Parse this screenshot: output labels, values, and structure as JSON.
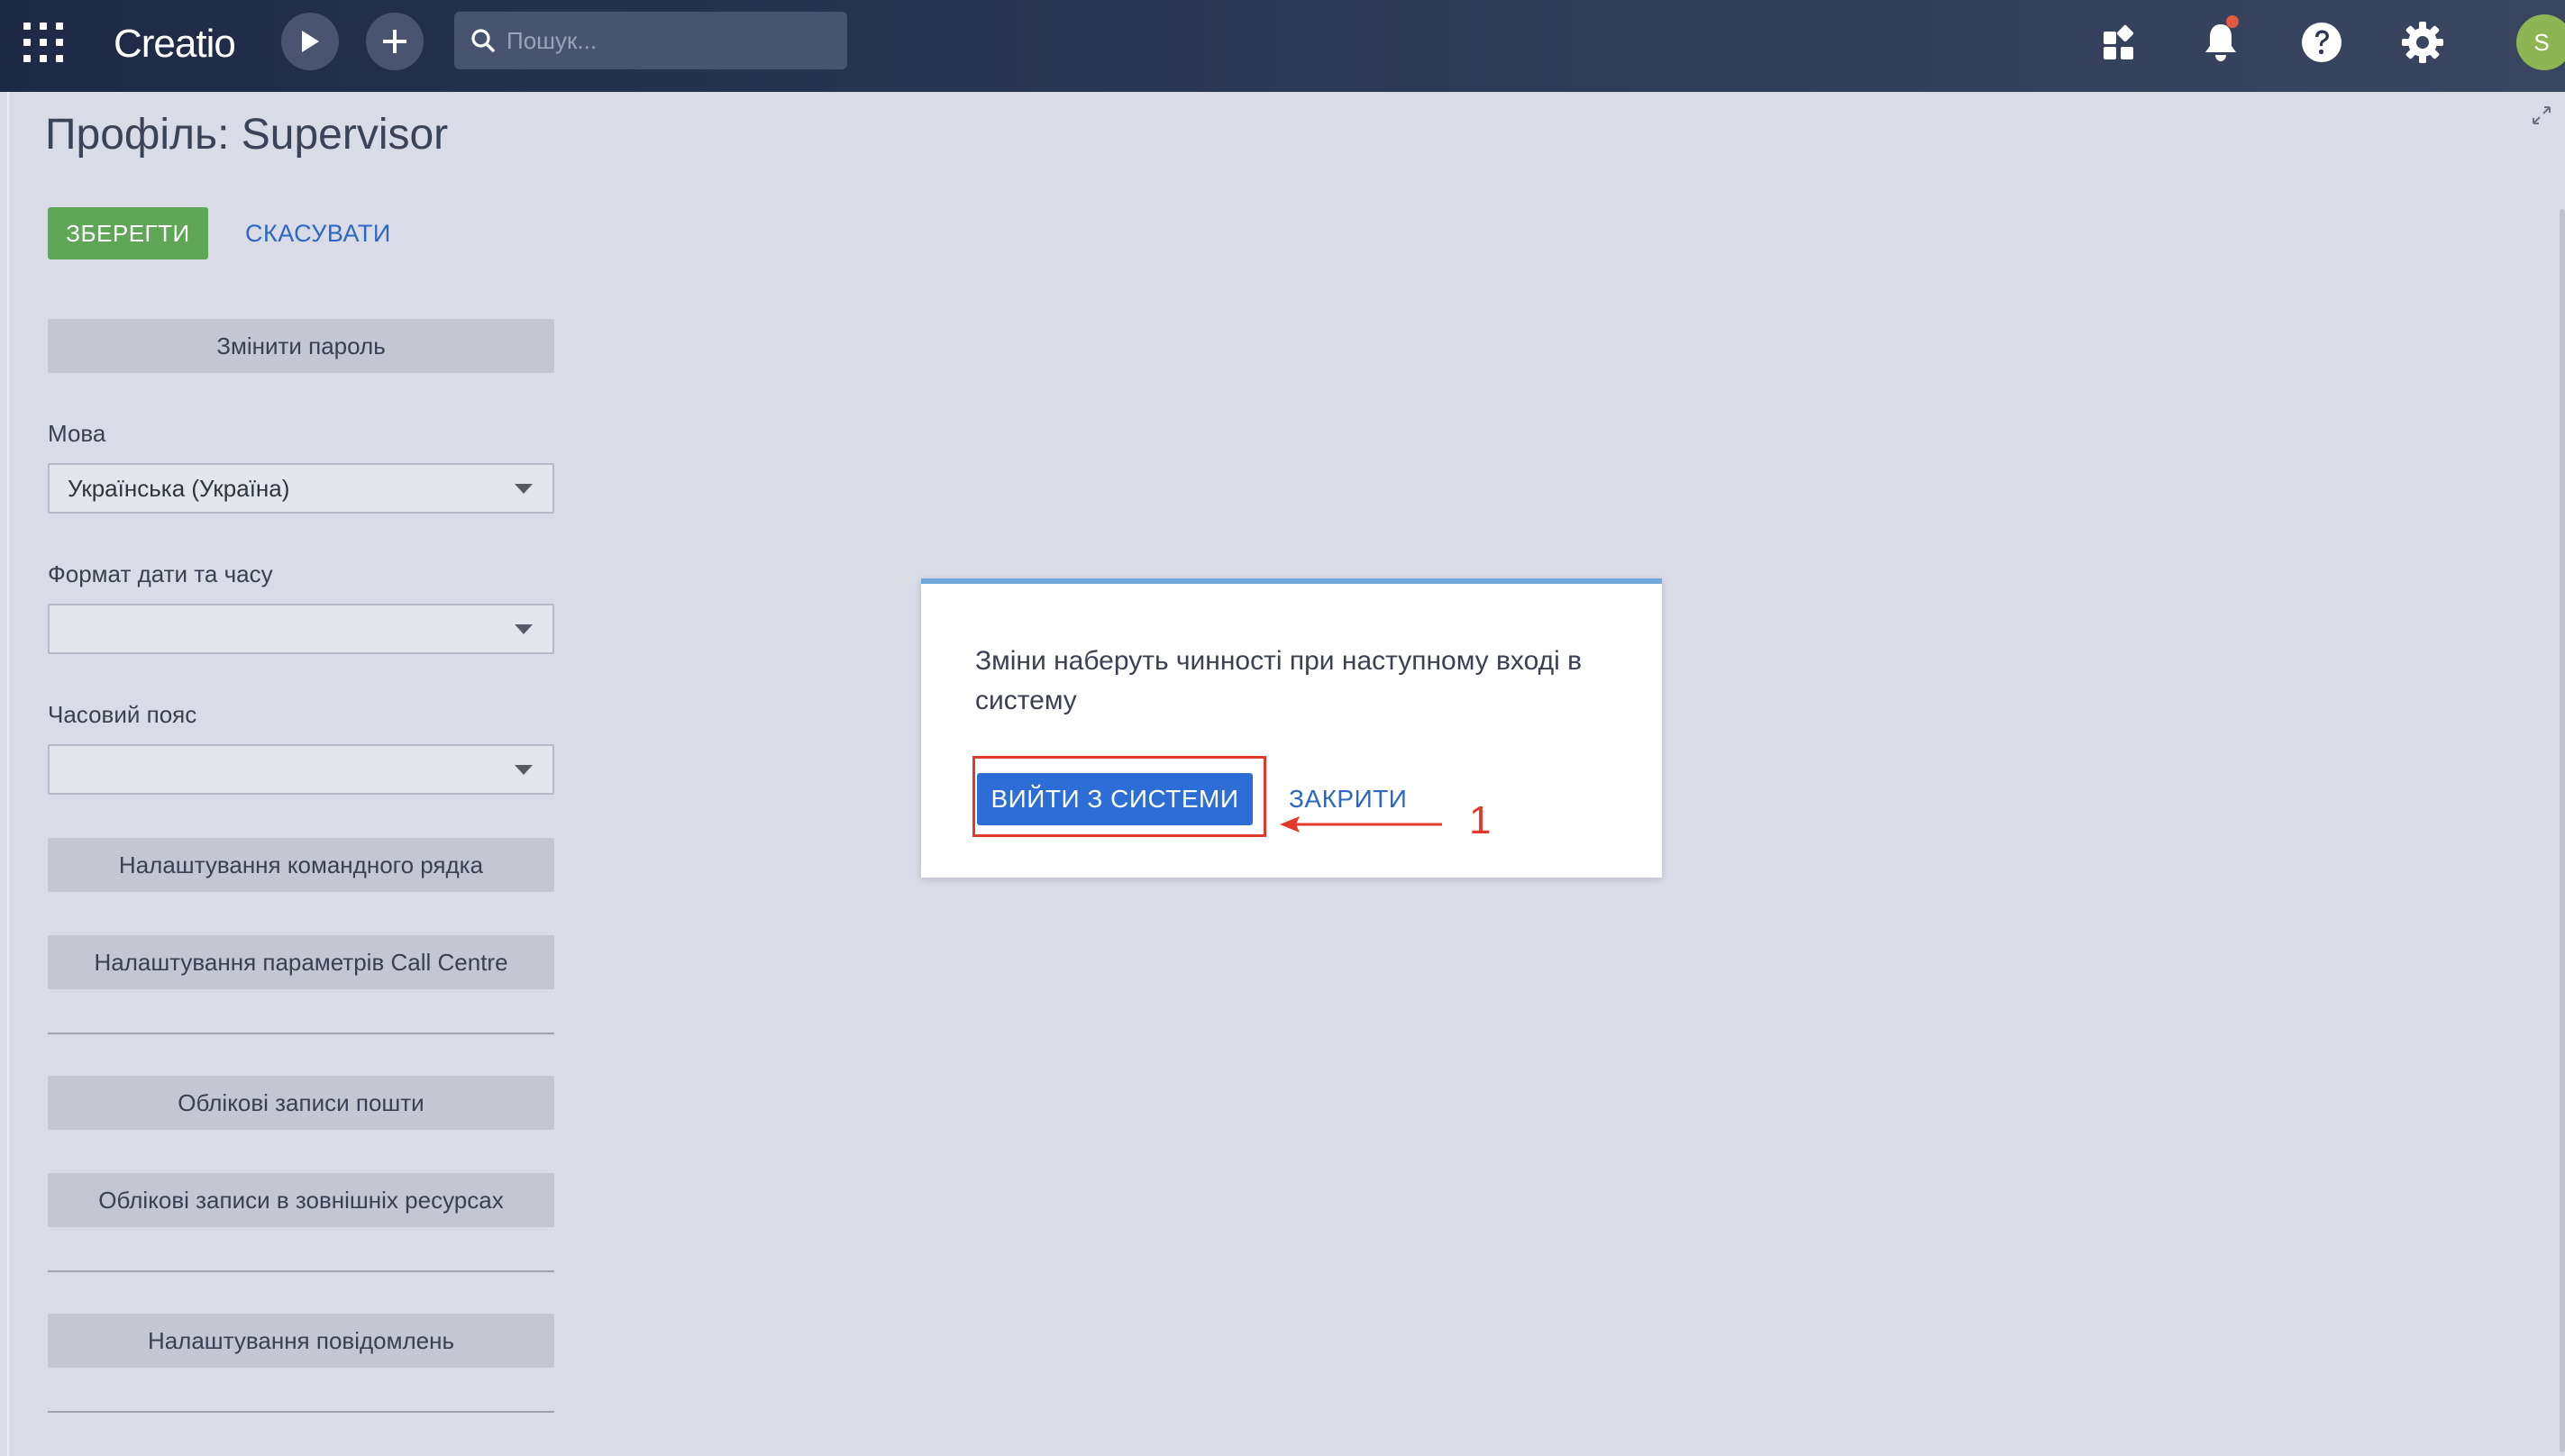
{
  "topbar": {
    "logo_text": "Creatio",
    "search_placeholder": "Пошук...",
    "avatar_initial": "S",
    "icons": [
      "apps-grid-icon",
      "play-icon",
      "plus-icon",
      "search-icon",
      "widgets-icon",
      "bell-icon",
      "help-icon",
      "gear-icon"
    ],
    "notification_dot_color": "#e25a3f"
  },
  "page": {
    "title": "Профіль: Supervisor",
    "save_label": "ЗБЕРЕГТИ",
    "cancel_label": "СКАСУВАТИ"
  },
  "profile": {
    "change_password": "Змінити пароль",
    "language_label": "Мова",
    "language_value": "Українська (Україна)",
    "datetime_format_label": "Формат дати та часу",
    "datetime_format_value": "",
    "timezone_label": "Часовий пояс",
    "timezone_value": "",
    "command_line_settings": "Налаштування командного рядка",
    "call_centre_settings": "Налаштування параметрів Call Centre",
    "email_accounts": "Облікові записи пошти",
    "external_accounts": "Облікові записи в зовнішніх ресурсах",
    "notification_settings": "Налаштування повідомлень"
  },
  "dialog": {
    "message": "Зміни наберуть чинності при наступному вході в систему",
    "logout_label": "ВИЙТИ З СИСТЕМИ",
    "close_label": "ЗАКРИТИ"
  },
  "annotation": {
    "number": "1",
    "color": "#e2392b"
  },
  "colors": {
    "save_button": "#5fa656",
    "primary_button": "#2c6ed5",
    "link": "#2d67c4",
    "dialog_top_border": "#6fa9dc"
  }
}
